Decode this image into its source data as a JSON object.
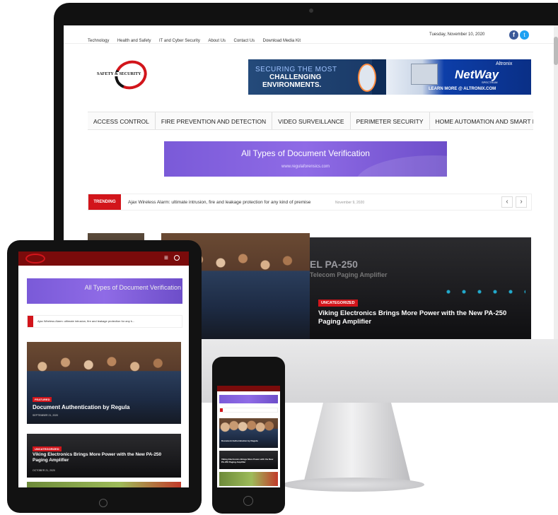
{
  "topbar": {
    "links": [
      "Technology",
      "Health and Safety",
      "IT and Cyber Security",
      "About Us",
      "Contact Us",
      "Download Media Kit"
    ],
    "date": "Tuesday, November 10, 2020"
  },
  "logo": {
    "text": "SAFETY & SECURITY"
  },
  "banner": {
    "left_line1": "SECURING THE MOST",
    "left_line2": "CHALLENGING",
    "left_line3": "ENVIRONMENTS.",
    "brand": "Altronix",
    "product": "NetWay",
    "product_sub": "SPECTRUM",
    "cta": "LEARN MORE @ ALTRONIX.COM"
  },
  "nav": [
    "ACCESS CONTROL",
    "FIRE PREVENTION AND DETECTION",
    "VIDEO SURVEILLANCE",
    "PERIMETER SECURITY",
    "HOME AUTOMATION AND SMART BUILDING"
  ],
  "ad": {
    "title": "All Types of Document Verification",
    "url": "www.regulaforensics.com"
  },
  "trending": {
    "label": "TRENDING",
    "headline": "Ajax Wireless Alarm: ultimate intrusion, fire and leakage protection for any kind of premise",
    "date": "November 9, 2020",
    "prev": "‹",
    "next": "›"
  },
  "hero": {
    "category": "UNCATEGORIZED",
    "title": "Viking Electronics Brings More Power with the New PA-250 Paging Amplifier",
    "overlay_line1": "EL PA-250",
    "overlay_line2": "Telecom Paging Amplifier"
  },
  "tablet": {
    "ad_title": "All Types of Document Verification",
    "trending_text": "Ajax Wireless Alarm: ultimate intrusion, fire and leakage protection for any k...",
    "post1_tag": "FEATURED",
    "post1_title": "Document Authentication by Regula",
    "post1_date": "SEPTEMBER 21, 2020",
    "post2_tag": "UNCATEGORIZED",
    "post2_title": "Viking Electronics Brings More Power with the New PA-250 Paging Amplifier",
    "post2_date": "OCTOBER 21, 2020"
  },
  "phone": {
    "post1_title": "Document Authentication by Regula",
    "post2_title": "Viking Electronics Brings More Power with the New PA-250 Paging Amplifier"
  },
  "colors": {
    "brand_red": "#d2151b",
    "dark_red": "#7a0b0b",
    "purple": "#7a5ad8",
    "facebook": "#3b5998",
    "twitter": "#1da1f2"
  }
}
